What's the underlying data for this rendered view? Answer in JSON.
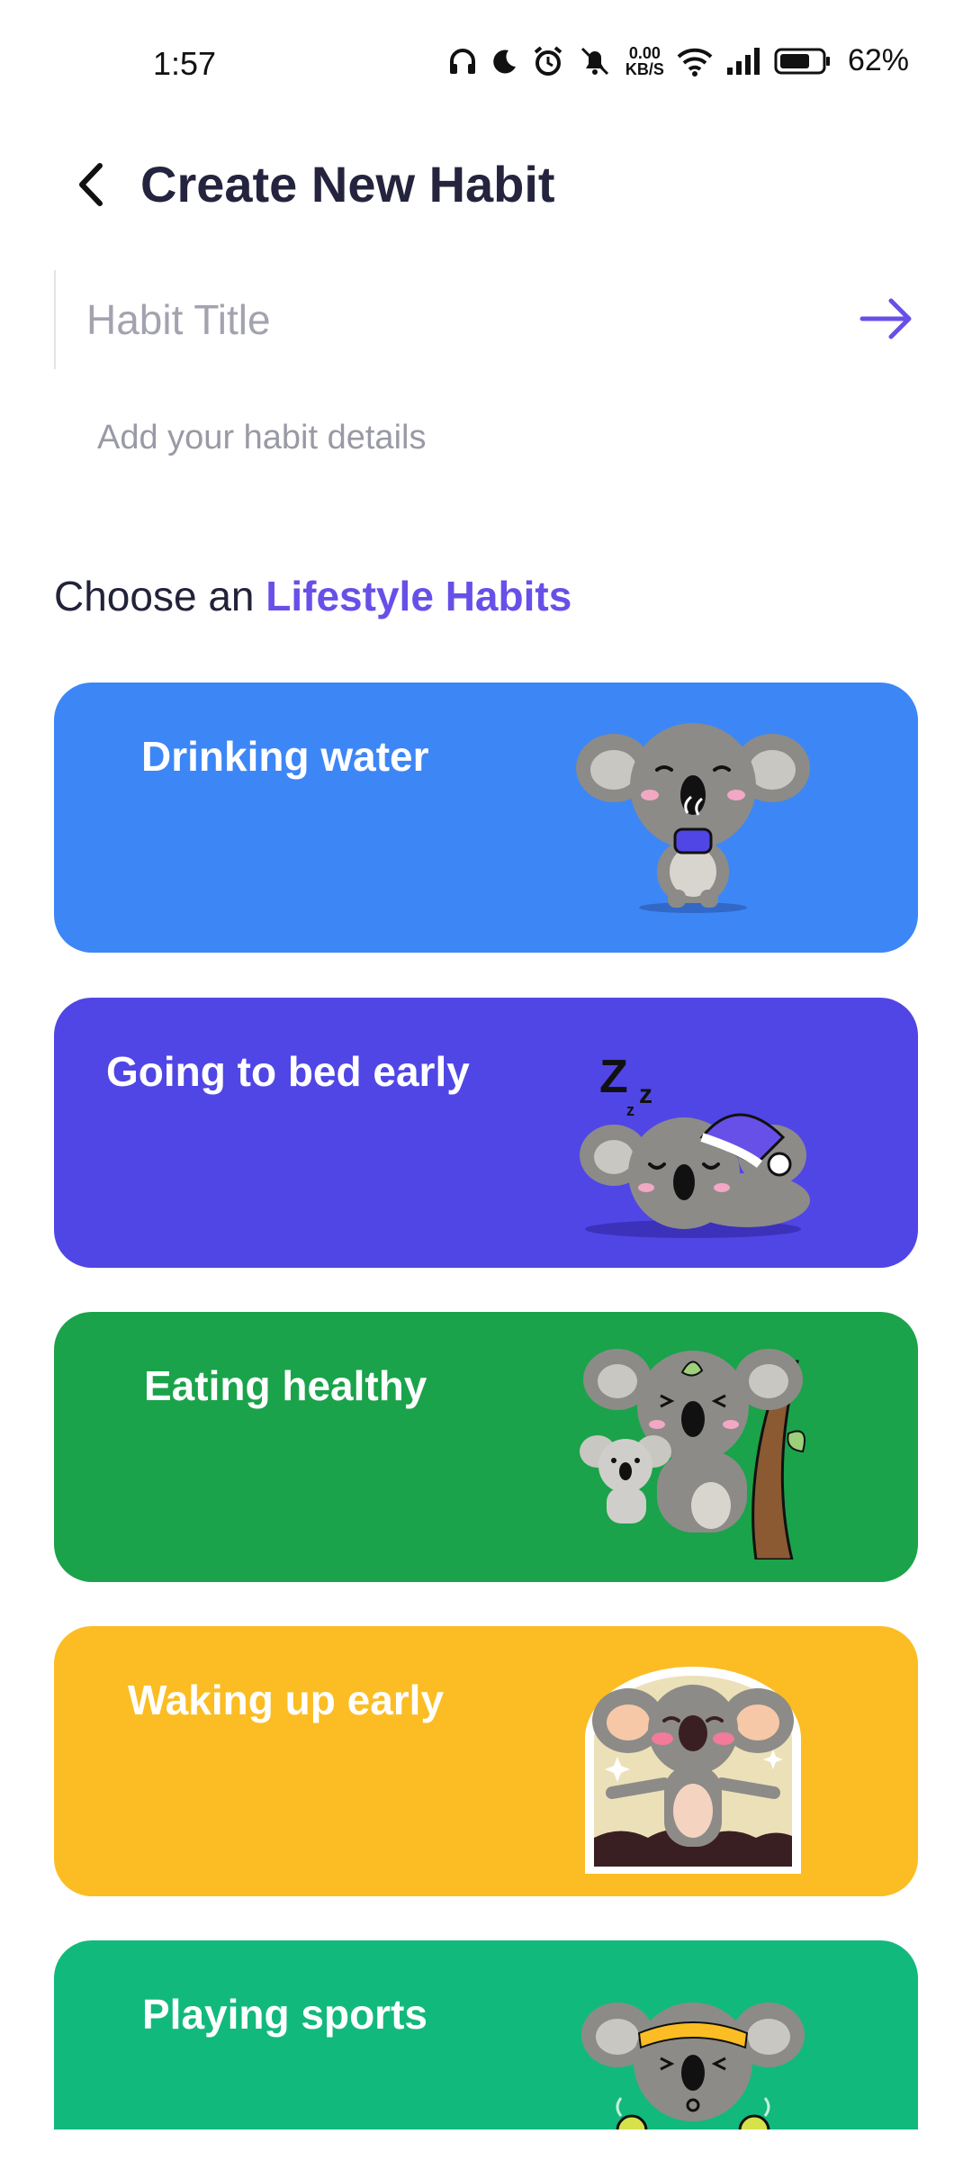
{
  "status_bar": {
    "time": "1:57",
    "net_speed_value": "0.00",
    "net_speed_unit": "KB/S",
    "battery": "62%"
  },
  "header": {
    "title": "Create New Habit"
  },
  "form": {
    "title_placeholder": "Habit Title",
    "details_link": "Add your habit details"
  },
  "section": {
    "prefix": "Choose an ",
    "accent": "Lifestyle Habits"
  },
  "colors": {
    "accent": "#6750e8",
    "card_blue": "#3d86f6",
    "card_purple": "#5046e5",
    "card_green": "#1aa34a",
    "card_yellow": "#fbbd23",
    "card_teal": "#12b97d"
  },
  "habits": [
    {
      "label": "Drinking water",
      "color": "#3d86f6",
      "illustration": "koala-drinking-icon"
    },
    {
      "label": "Going to bed early",
      "color": "#5046e5",
      "illustration": "koala-sleeping-icon"
    },
    {
      "label": "Eating healthy",
      "color": "#1aa34a",
      "illustration": "koala-tree-icon"
    },
    {
      "label": "Waking up early",
      "color": "#fbbd23",
      "illustration": "koala-waking-icon"
    },
    {
      "label": "Playing sports",
      "color": "#12b97d",
      "illustration": "koala-sports-icon"
    }
  ]
}
